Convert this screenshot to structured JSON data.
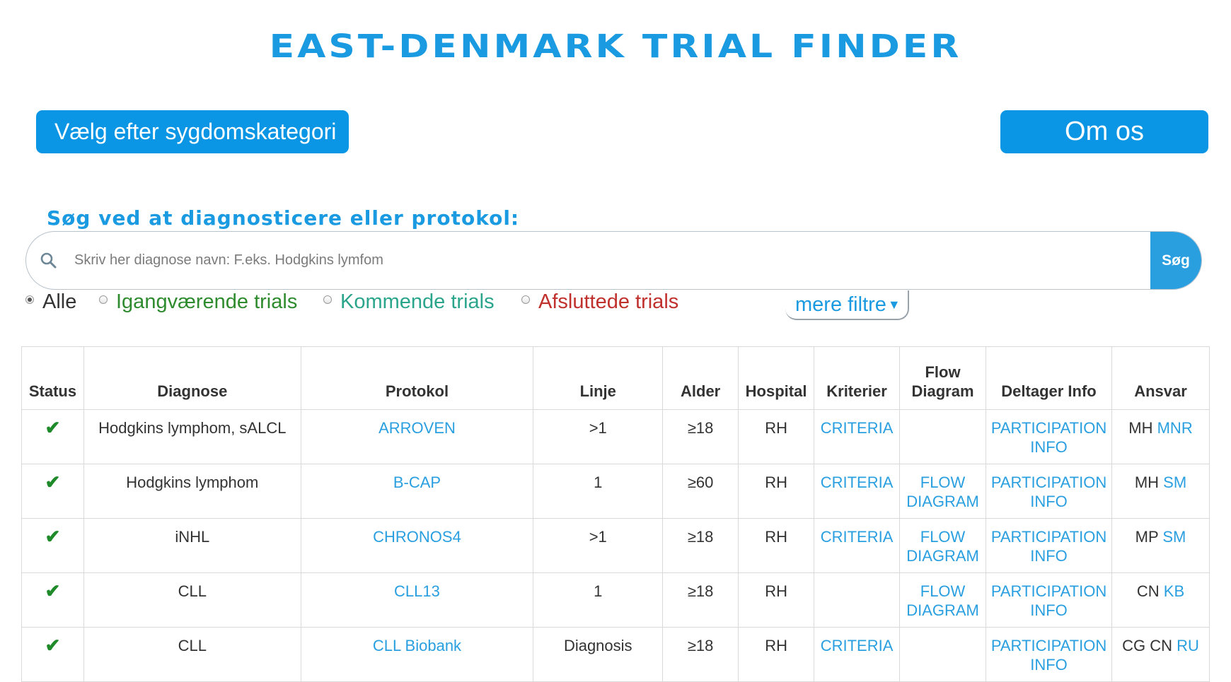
{
  "header": {
    "title": "EAST-DENMARK TRIAL FINDER",
    "category_button": "Vælg efter sygdomskategori",
    "about_button": "Om os"
  },
  "search": {
    "label": "Søg ved at diagnosticere eller protokol:",
    "placeholder": "Skriv her diagnose navn: F.eks. Hodgkins lymfom",
    "value": "",
    "button": "Søg"
  },
  "filters": {
    "options": [
      {
        "label": "Alle",
        "checked": true,
        "color": "#333333"
      },
      {
        "label": "Igangværende trials",
        "checked": false,
        "color": "#2e8b2e"
      },
      {
        "label": "Kommende trials",
        "checked": false,
        "color": "#2aa58c"
      },
      {
        "label": "Afsluttede trials",
        "checked": false,
        "color": "#c0302c"
      }
    ],
    "more": "mere filtre"
  },
  "table": {
    "headers": {
      "status": "Status",
      "diagnose": "Diagnose",
      "protokol": "Protokol",
      "linje": "Linje",
      "alder": "Alder",
      "hospital": "Hospital",
      "kriterier": "Kriterier",
      "flow1": "Flow",
      "flow2": "Diagram",
      "deltager": "Deltager Info",
      "ansvar": "Ansvar"
    },
    "rows": [
      {
        "status": "✔",
        "diagnose": "Hodgkins lymphom, sALCL",
        "protokol": "ARROVEN",
        "linje": ">1",
        "alder": "≥18",
        "hospital": "RH",
        "kriterier": "CRITERIA",
        "flow1": "",
        "flow2": "",
        "part1": "PARTICIPATION",
        "part2": "INFO",
        "ansvar_plain": "MH",
        "ansvar_link": "MNR"
      },
      {
        "status": "✔",
        "diagnose": "Hodgkins lymphom",
        "protokol": "B-CAP",
        "linje": "1",
        "alder": "≥60",
        "hospital": "RH",
        "kriterier": "CRITERIA",
        "flow1": "FLOW",
        "flow2": "DIAGRAM",
        "part1": "PARTICIPATION",
        "part2": "INFO",
        "ansvar_plain": "MH",
        "ansvar_link": "SM"
      },
      {
        "status": "✔",
        "diagnose": "iNHL",
        "protokol": "CHRONOS4",
        "linje": ">1",
        "alder": "≥18",
        "hospital": "RH",
        "kriterier": "CRITERIA",
        "flow1": "FLOW",
        "flow2": "DIAGRAM",
        "part1": "PARTICIPATION",
        "part2": "INFO",
        "ansvar_plain": "MP",
        "ansvar_link": "SM"
      },
      {
        "status": "✔",
        "diagnose": "CLL",
        "protokol": "CLL13",
        "linje": "1",
        "alder": "≥18",
        "hospital": "RH",
        "kriterier": "",
        "flow1": "FLOW",
        "flow2": "DIAGRAM",
        "part1": "PARTICIPATION",
        "part2": "INFO",
        "ansvar_plain": "CN",
        "ansvar_link": "KB"
      },
      {
        "status": "✔",
        "diagnose": "CLL",
        "protokol": "CLL Biobank",
        "linje": "Diagnosis",
        "alder": "≥18",
        "hospital": "RH",
        "kriterier": "CRITERIA",
        "flow1": "",
        "flow2": "",
        "part1": "PARTICIPATION",
        "part2": "INFO",
        "ansvar_plain": "CG CN",
        "ansvar_link": "RU"
      }
    ]
  },
  "colors": {
    "accent": "#0b96e5",
    "link": "#2a9fe0",
    "check": "#1f8a2a"
  }
}
